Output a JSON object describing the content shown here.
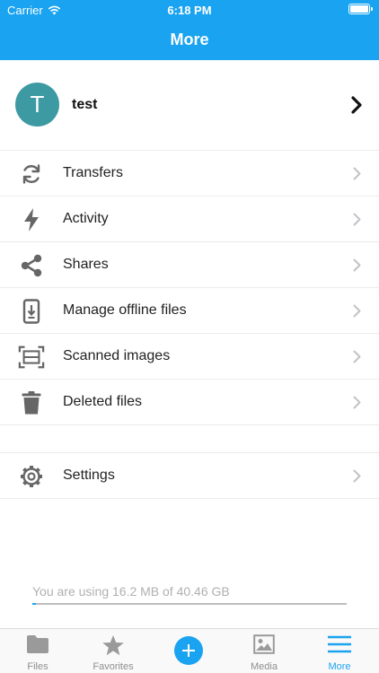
{
  "status_bar": {
    "carrier": "Carrier",
    "time": "6:18 PM"
  },
  "nav": {
    "title": "More"
  },
  "profile": {
    "initial": "T",
    "name": "test"
  },
  "menu": {
    "items": [
      {
        "label": "Transfers",
        "icon": "transfer-icon"
      },
      {
        "label": "Activity",
        "icon": "lightning-icon"
      },
      {
        "label": "Shares",
        "icon": "share-icon"
      },
      {
        "label": "Manage offline files",
        "icon": "phone-download-icon"
      },
      {
        "label": "Scanned images",
        "icon": "scanner-icon"
      },
      {
        "label": "Deleted files",
        "icon": "trash-icon"
      }
    ],
    "settings": {
      "label": "Settings",
      "icon": "gear-icon"
    }
  },
  "storage": {
    "text": "You are using 16.2 MB of 40.46 GB",
    "used_fraction": 0.01
  },
  "tabs": [
    {
      "label": "Files",
      "icon": "folder-icon"
    },
    {
      "label": "Favorites",
      "icon": "star-icon"
    },
    {
      "label": "",
      "icon": "plus-icon"
    },
    {
      "label": "Media",
      "icon": "image-icon"
    },
    {
      "label": "More",
      "icon": "menu-icon",
      "active": true
    }
  ],
  "colors": {
    "accent": "#1aa3f0",
    "avatar": "#3d9aa3"
  }
}
